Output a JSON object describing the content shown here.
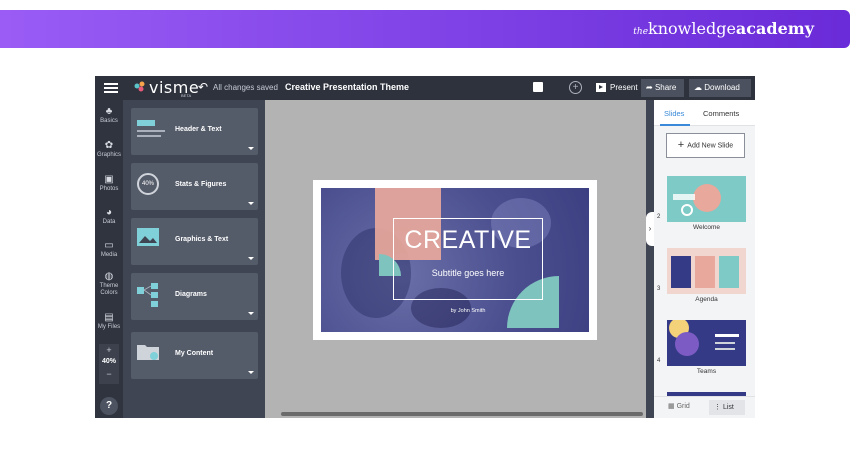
{
  "banner": {
    "brand_prefix": "the",
    "brand_word1": "knowledge",
    "brand_word2": "academy"
  },
  "topbar": {
    "app_name": "visme",
    "beta": "BETA",
    "save_status": "All changes saved",
    "document_title": "Creative Presentation Theme",
    "present_label": "Present",
    "share_label": "Share",
    "download_label": "Download"
  },
  "iconbar": {
    "items": [
      {
        "label": "Basics",
        "icon": "basics-icon"
      },
      {
        "label": "Graphics",
        "icon": "graphics-icon"
      },
      {
        "label": "Photos",
        "icon": "photos-icon"
      },
      {
        "label": "Data",
        "icon": "data-icon"
      },
      {
        "label": "Media",
        "icon": "media-icon"
      },
      {
        "label": "Theme Colors",
        "icon": "palette-icon"
      },
      {
        "label": "My Files",
        "icon": "files-icon"
      }
    ],
    "zoom": "40%",
    "help": "?"
  },
  "panel": {
    "cards": [
      {
        "label": "Header & Text"
      },
      {
        "label": "Stats & Figures",
        "badge": "40%"
      },
      {
        "label": "Graphics & Text"
      },
      {
        "label": "Diagrams"
      },
      {
        "label": "My Content"
      }
    ]
  },
  "slide": {
    "title": "CREATIVE",
    "subtitle": "Subtitle goes here",
    "byline": "by John Smith"
  },
  "rpanel": {
    "tabs": [
      "Slides",
      "Comments"
    ],
    "add_slide": "Add New Slide",
    "thumbs": [
      {
        "num": "2",
        "label": "Welcome"
      },
      {
        "num": "3",
        "label": "Agenda"
      },
      {
        "num": "4",
        "label": "Teams"
      }
    ],
    "grid_label": "Grid",
    "list_label": "List"
  },
  "colors": {
    "banner": "#7b3fe4",
    "accent_blue": "#3a8ad9",
    "slide_pink": "#e8a89b",
    "slide_teal": "#7fc3bf",
    "slide_indigo": "#4b4f8f"
  }
}
